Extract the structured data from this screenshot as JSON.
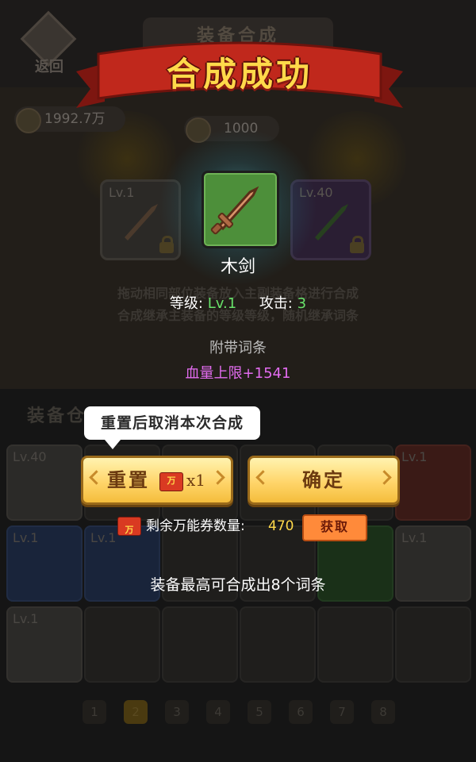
{
  "background": {
    "back_label": "返回",
    "screen_title": "装备合成",
    "gold_amount": "1992.7万",
    "cost_amount": "1000",
    "slots": [
      {
        "level": "Lv.1"
      },
      {
        "level": "Lv.40"
      }
    ],
    "hint_1": "拖动相同部位装备放入主副装备格进行合成",
    "hint_2": "合成继承主装备的等级等级，随机继承词条",
    "section_label": "装备仓库",
    "grid": [
      {
        "level": "Lv.40",
        "color": "grey"
      },
      {
        "level": "",
        "color": "empty"
      },
      {
        "level": "",
        "color": "empty"
      },
      {
        "level": "",
        "color": "empty"
      },
      {
        "level": "",
        "color": "empty"
      },
      {
        "level": "Lv.1",
        "color": "red"
      },
      {
        "level": "Lv.1",
        "color": "blue"
      },
      {
        "level": "Lv.1",
        "color": "blue"
      },
      {
        "level": "",
        "color": "empty"
      },
      {
        "level": "",
        "color": "empty"
      },
      {
        "level": "",
        "color": "green"
      },
      {
        "level": "Lv.1",
        "color": "grey"
      },
      {
        "level": "Lv.1",
        "color": "grey"
      }
    ],
    "pages": [
      "1",
      "2",
      "3",
      "4",
      "5",
      "6",
      "7",
      "8"
    ],
    "active_page": "2"
  },
  "popup": {
    "title": "合成成功",
    "item_icon": "wooden-sword-icon",
    "item_name": "木剑",
    "level_label": "等级:",
    "level_value": "Lv.1",
    "attack_label": "攻击:",
    "attack_value": "3",
    "affix_title": "附带词条",
    "affix": "血量上限+1541",
    "tooltip": "重置后取消本次合成",
    "reset_label": "重置",
    "reset_cost_icon": "万",
    "reset_cost_times": "x1",
    "confirm_label": "确定",
    "remain_label": "剩余万能券数量:",
    "remain_value": "470",
    "get_label": "获取",
    "max_note": "装备最高可合成出8个词条"
  },
  "colors": {
    "ribbon_red": "#c0281c",
    "title_gold": "#ffd94a",
    "stat_green": "#68e26a",
    "affix_purple": "#e36cf0",
    "button_gold": "#ffd56a",
    "get_orange": "#ff8a3a"
  }
}
